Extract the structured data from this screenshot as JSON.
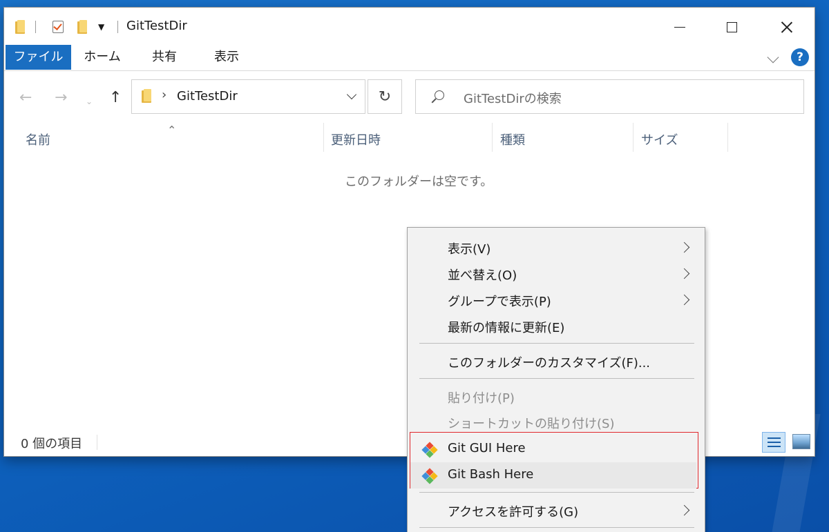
{
  "window": {
    "title": "GitTestDir",
    "tabs": [
      "ファイル",
      "ホーム",
      "共有",
      "表示"
    ],
    "help_glyph": "?"
  },
  "navigation": {
    "address_path": "GitTestDir",
    "search_placeholder": "GitTestDirの検索"
  },
  "columns": [
    "名前",
    "更新日時",
    "種類",
    "サイズ"
  ],
  "content": {
    "empty_message": "このフォルダーは空です。"
  },
  "status": {
    "item_count": "0 個の項目"
  },
  "context_menu": {
    "items": [
      {
        "label": "表示(V)",
        "submenu": true,
        "enabled": true
      },
      {
        "label": "並べ替え(O)",
        "submenu": true,
        "enabled": true
      },
      {
        "label": "グループで表示(P)",
        "submenu": true,
        "enabled": true
      },
      {
        "label": "最新の情報に更新(E)",
        "submenu": false,
        "enabled": true
      },
      {
        "label": "このフォルダーのカスタマイズ(F)...",
        "submenu": false,
        "enabled": true
      },
      {
        "label": "貼り付け(P)",
        "submenu": false,
        "enabled": false
      },
      {
        "label": "ショートカットの貼り付け(S)",
        "submenu": false,
        "enabled": false
      },
      {
        "label": "Git GUI Here",
        "submenu": false,
        "enabled": true,
        "icon": "git-icon"
      },
      {
        "label": "Git Bash Here",
        "submenu": false,
        "enabled": true,
        "icon": "git-icon",
        "hovered": true
      },
      {
        "label": "アクセスを許可する(G)",
        "submenu": true,
        "enabled": true
      }
    ],
    "highlight_color": "#e0262b"
  },
  "colors": {
    "accent": "#1a6ec1",
    "desktop": "#0e63bf"
  }
}
